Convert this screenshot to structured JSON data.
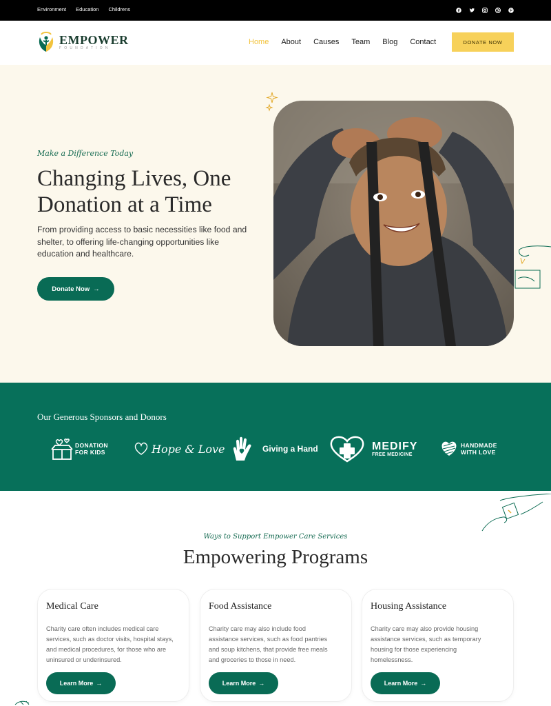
{
  "topbar": {
    "links": [
      "Environment",
      "Education",
      "Childrens"
    ],
    "social_icons": [
      "facebook-icon",
      "twitter-icon",
      "instagram-icon",
      "dribbble-icon",
      "pinterest-icon"
    ]
  },
  "header": {
    "brand": "EMPOWER",
    "brand_sub": "FOUNDATION",
    "nav": [
      "Home",
      "About",
      "Causes",
      "Team",
      "Blog",
      "Contact"
    ],
    "active_nav": "Home",
    "donate_label": "DONATE NOW"
  },
  "hero": {
    "kicker": "Make a Difference Today",
    "title": "Changing Lives, One Donation at a Time",
    "description": "From providing access to basic necessities like food and shelter, to offering life-changing opportunities like education and healthcare.",
    "cta_label": "Donate Now",
    "cta_arrow": "→"
  },
  "sponsors": {
    "title": "Our Generous Sponsors and Donors",
    "logos": {
      "donation_kids_1": "DONATION",
      "donation_kids_2": "FOR KIDS",
      "hope_love": "Hope & Love",
      "giving_hand": "Giving a Hand",
      "medify": "MEDIFY",
      "medify_sub": "FREE MEDICINE",
      "handmade_1": "HANDMADE",
      "handmade_2": "WITH LOVE"
    }
  },
  "programs": {
    "kicker": "Ways to Support Empower Care Services",
    "title": "Empowering Programs",
    "cards": [
      {
        "title": "Medical Care",
        "text": "Charity care often includes medical care services, such as doctor visits, hospital stays, and medical procedures, for those who are uninsured or underinsured.",
        "button": "Learn More"
      },
      {
        "title": "Food Assistance",
        "text": "Charity care may also include food assistance services, such as food pantries and soup kitchens, that provide free meals and groceries to those in need.",
        "button": "Learn More"
      },
      {
        "title": "Housing Assistance",
        "text": "Charity care may also provide housing assistance services, such as temporary housing for those experiencing homelessness.",
        "button": "Learn More"
      }
    ],
    "arrow": "→"
  },
  "colors": {
    "brand_green": "#096b55",
    "accent_yellow": "#f7d15a",
    "hero_bg": "#fcf8ec",
    "sponsor_bg": "#07705a"
  }
}
